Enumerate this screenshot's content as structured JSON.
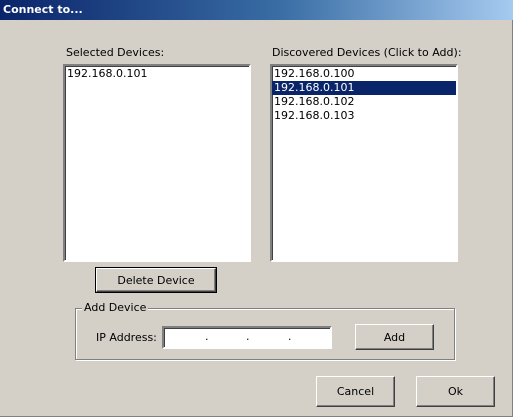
{
  "window": {
    "title": "Connect to..."
  },
  "selected_devices": {
    "label": "Selected Devices:",
    "items": [
      "192.168.0.101"
    ]
  },
  "discovered_devices": {
    "label": "Discovered Devices (Click to Add):",
    "items": [
      "192.168.0.100",
      "192.168.0.101",
      "192.168.0.102",
      "192.168.0.103"
    ],
    "selected_index": 1
  },
  "delete_button": {
    "label": "Delete Device"
  },
  "add_device": {
    "group_label": "Add Device",
    "ip_label": "IP Address:",
    "ip_value": "",
    "ip_separators": [
      ".",
      ".",
      "."
    ],
    "add_label": "Add"
  },
  "footer": {
    "cancel_label": "Cancel",
    "ok_label": "Ok"
  }
}
